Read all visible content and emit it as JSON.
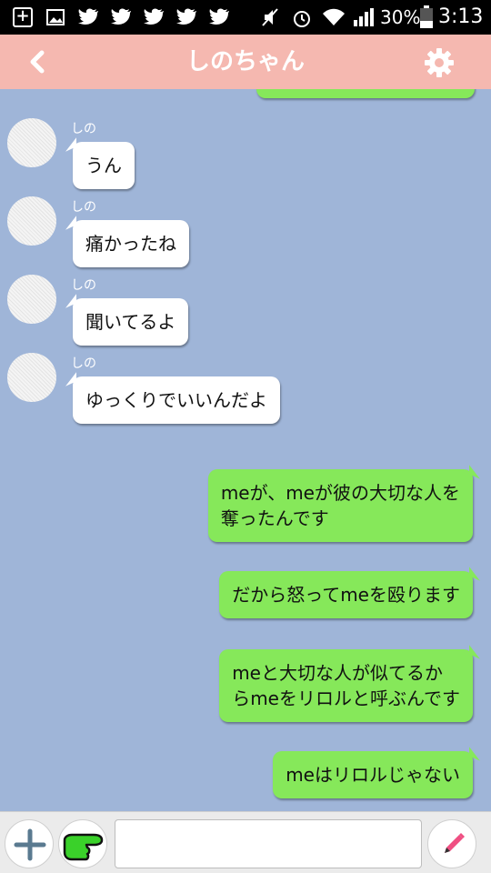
{
  "status_bar": {
    "battery": "30%",
    "time": "3:13",
    "icons": [
      "add-box-icon",
      "image-icon",
      "twitter-icon",
      "twitter-icon",
      "twitter-icon",
      "twitter-icon",
      "twitter-icon",
      "mute-icon",
      "alarm-icon",
      "wifi-icon",
      "signal-icon",
      "battery-icon"
    ]
  },
  "header": {
    "title": "しのちゃん",
    "back_icon": "chevron-left-icon",
    "settings_icon": "gear-icon",
    "color": "#f5b8b0"
  },
  "chat": {
    "background": "#9fb5d8",
    "incoming_color": "#ffffff",
    "outgoing_color": "#86e85a",
    "incoming": [
      {
        "sender": "しの",
        "text": "うん"
      },
      {
        "sender": "しの",
        "text": "痛かったね"
      },
      {
        "sender": "しの",
        "text": "聞いてるよ"
      },
      {
        "sender": "しの",
        "text": "ゆっくりでいいんだよ"
      }
    ],
    "outgoing": [
      {
        "line1": "meが、meが彼の大切な人を",
        "line2": "奪ったんです"
      },
      {
        "line1": "だから怒ってmeを殴ります"
      },
      {
        "line1": "meと大切な人が似てるか",
        "line2": "らmeをリロルと呼ぶんです"
      },
      {
        "line1": "meはリロルじゃない"
      }
    ]
  },
  "input_bar": {
    "plus_icon": "plus-icon",
    "sticker_icon": "pointing-hand-icon",
    "send_icon": "pencil-icon",
    "message_value": "",
    "placeholder": ""
  }
}
